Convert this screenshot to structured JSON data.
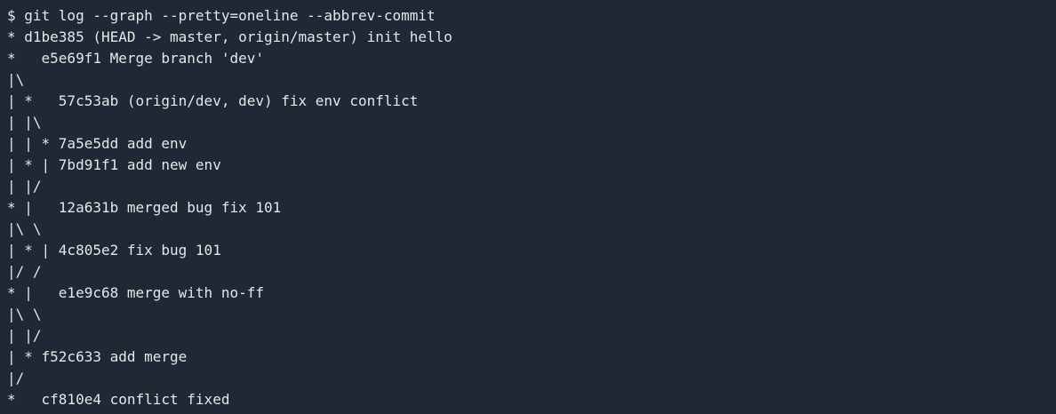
{
  "terminal": {
    "lines": [
      "$ git log --graph --pretty=oneline --abbrev-commit",
      "* d1be385 (HEAD -> master, origin/master) init hello",
      "*   e5e69f1 Merge branch 'dev'",
      "|\\",
      "| *   57c53ab (origin/dev, dev) fix env conflict",
      "| |\\",
      "| | * 7a5e5dd add env",
      "| * | 7bd91f1 add new env",
      "| |/",
      "* |   12a631b merged bug fix 101",
      "|\\ \\",
      "| * | 4c805e2 fix bug 101",
      "|/ /",
      "* |   e1e9c68 merge with no-ff",
      "|\\ \\",
      "| |/",
      "| * f52c633 add merge",
      "|/",
      "*   cf810e4 conflict fixed"
    ]
  },
  "colors": {
    "background": "#1f2834",
    "foreground": "#e6e6e6"
  }
}
